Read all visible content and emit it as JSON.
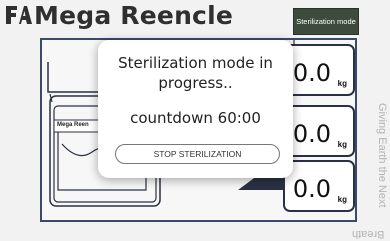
{
  "header": {
    "logo_icon": "e-a-monogram-icon",
    "title": "Mega Reencle",
    "mode_button_label": "Sterilization mode"
  },
  "device": {
    "label": "Mega Reen",
    "scales": [
      {
        "value": "50.0",
        "unit": "kg"
      },
      {
        "value": "0.0",
        "unit": "kg"
      },
      {
        "value": "0.0",
        "unit": "kg"
      }
    ]
  },
  "side_text": {
    "vertical": "Giving Earth the Next",
    "bottom": "Breath"
  },
  "modal": {
    "title": "Sterilization mode in progress..",
    "countdown": "countdown 60:00",
    "stop_label": "STOP STERILIZATION"
  },
  "colors": {
    "panel_border": "#3a4a6a",
    "dark_button": "#3d4a3e",
    "scale_border": "#2b3144"
  }
}
